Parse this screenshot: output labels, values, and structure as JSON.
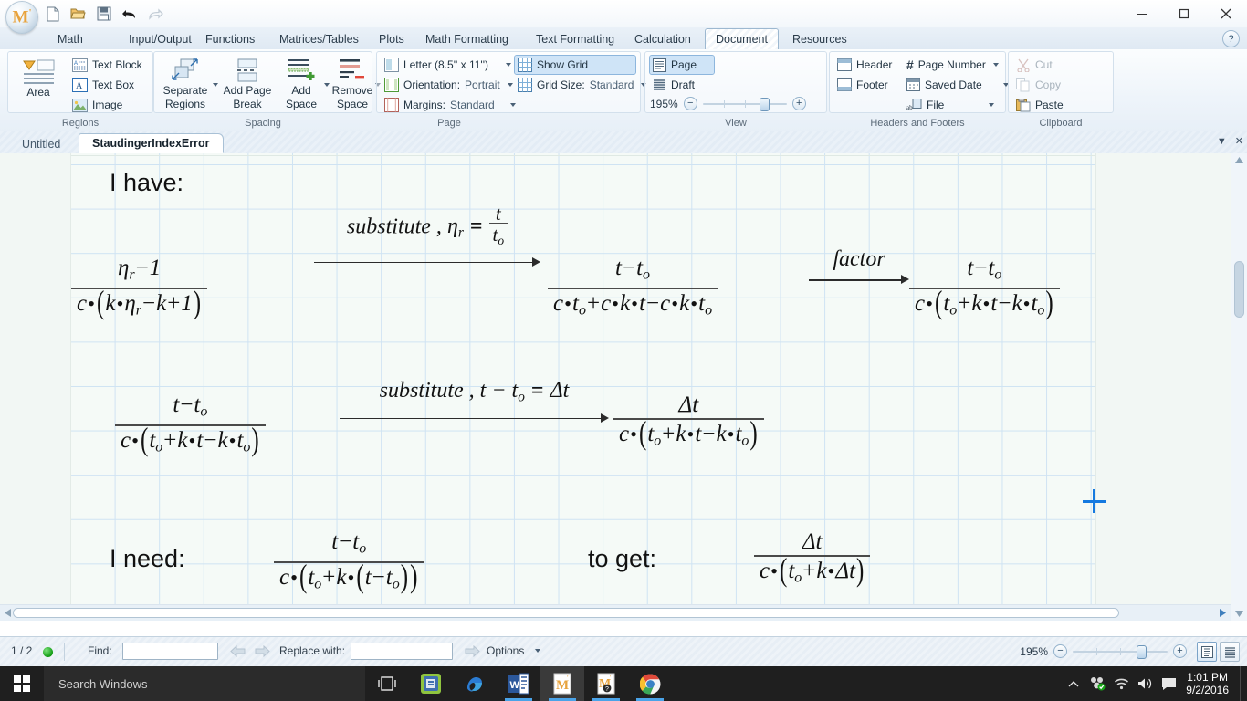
{
  "titlebar": {
    "logo_letter": "M",
    "logo_prime": "'",
    "quick_access": [
      {
        "name": "new-document-icon",
        "label": "New"
      },
      {
        "name": "open-document-icon",
        "label": "Open"
      },
      {
        "name": "save-document-icon",
        "label": "Save"
      },
      {
        "name": "undo-icon",
        "label": "Undo"
      },
      {
        "name": "redo-icon",
        "label": "Redo"
      }
    ],
    "window_controls": [
      {
        "name": "minimize-button",
        "glyph": "–"
      },
      {
        "name": "maximize-button",
        "glyph": "❐"
      },
      {
        "name": "close-button",
        "glyph": "✕"
      }
    ]
  },
  "ribbon": {
    "tabs": [
      {
        "label": "Math",
        "active": false
      },
      {
        "label": "Input/Output",
        "active": false
      },
      {
        "label": "Functions",
        "active": false
      },
      {
        "label": "Matrices/Tables",
        "active": false
      },
      {
        "label": "Plots",
        "active": false
      },
      {
        "label": "Math Formatting",
        "active": false
      },
      {
        "label": "Text Formatting",
        "active": false
      },
      {
        "label": "Calculation",
        "active": false
      },
      {
        "label": "Document",
        "active": true
      },
      {
        "label": "Resources",
        "active": false
      }
    ],
    "help_label": "?",
    "groups": {
      "regions": {
        "title": "Regions",
        "area_label": "Area",
        "items": [
          {
            "label": "Text Block",
            "icon": "text-block-icon"
          },
          {
            "label": "Text Box",
            "icon": "text-box-icon"
          },
          {
            "label": "Image",
            "icon": "image-icon"
          }
        ]
      },
      "spacing": {
        "title": "Spacing",
        "items": [
          {
            "label1": "Separate",
            "label2": "Regions",
            "icon": "separate-regions-icon",
            "has_caret": true
          },
          {
            "label1": "Add Page",
            "label2": "Break",
            "icon": "add-page-break-icon",
            "has_caret": false
          },
          {
            "label1": "Add",
            "label2": "Space",
            "icon": "add-space-icon",
            "has_caret": true
          },
          {
            "label1": "Remove",
            "label2": "Space",
            "icon": "remove-space-icon",
            "has_caret": true
          }
        ]
      },
      "page": {
        "title": "Page",
        "paper_size_label": "Letter (8.5'' x 11'')",
        "orientation_label": "Orientation:",
        "orientation_value": "Portrait",
        "margins_label": "Margins:",
        "margins_value": "Standard",
        "show_grid_label": "Show Grid",
        "show_grid_on": true,
        "grid_size_label": "Grid Size:",
        "grid_size_value": "Standard"
      },
      "view": {
        "title": "View",
        "page_label": "Page",
        "draft_label": "Draft",
        "page_selected": true,
        "zoom_percent": "195%"
      },
      "headers_footers": {
        "title": "Headers and Footers",
        "header_label": "Header",
        "footer_label": "Footer",
        "page_number_label": "Page Number",
        "saved_date_label": "Saved Date",
        "file_label": "File"
      },
      "clipboard": {
        "title": "Clipboard",
        "cut_label": "Cut",
        "copy_label": "Copy",
        "paste_label": "Paste"
      }
    }
  },
  "document_tabs": {
    "tabs": [
      {
        "label": "Untitled",
        "active": false
      },
      {
        "label": "StaudingerIndexError",
        "active": true
      }
    ]
  },
  "worksheet": {
    "label_have": "I have:",
    "label_need": "I need:",
    "label_to_get": "to get:",
    "row1": {
      "expr1": {
        "num": "ηr − 1",
        "den": "c · (k · ηr − k + 1)",
        "num_parts": {
          "eta": "η",
          "sub": "r",
          "rest": "− 1"
        }
      },
      "arrow1_label": "substitute ,",
      "arrow1_eq_lhs": "η",
      "arrow1_eq_lhs_sub": "r",
      "arrow1_eq_op": "=",
      "arrow1_frac_num": "t",
      "arrow1_frac_den": "t",
      "arrow1_frac_den_sub": "o",
      "expr2": {
        "num": "t − t o",
        "den": "c · t o + c · k · t − c · k · t o"
      },
      "arrow2_label": "factor",
      "expr3": {
        "num": "t − t o",
        "den": "c · ( t o + k · t − k · t o )"
      }
    },
    "row2": {
      "expr4": {
        "num": "t − t o",
        "den": "c · ( t o + k · t − k · t o )"
      },
      "arrow3_label": "substitute , t − t",
      "arrow3_sub": "o",
      "arrow3_eq": "=",
      "arrow3_rhs": "Δt",
      "expr5": {
        "num": "Δt",
        "den": "c · ( t o + k · t − k · t o )"
      }
    },
    "row3": {
      "expr6": {
        "num": "t − t o",
        "den": "c · ( t o + k · ( t − t o ) )"
      },
      "expr7": {
        "num": "Δt",
        "den": "c · ( t o + k · Δt )"
      }
    },
    "symbols": {
      "eta": "η",
      "delta": "Δ",
      "minus": "−",
      "plus": "+",
      "dot": "•",
      "equals": "=",
      "lparen": "(",
      "rparen": ")",
      "c": "c",
      "k": "k",
      "t": "t",
      "sub_o": "o",
      "sub_r": "r",
      "one": "1"
    }
  },
  "statusbar": {
    "page_indicator": "1 / 2",
    "find_label": "Find:",
    "find_value": "",
    "replace_label": "Replace with:",
    "replace_value": "",
    "options_label": "Options",
    "zoom_percent": "195%"
  },
  "taskbar": {
    "search_placeholder": "Search Windows",
    "apps": [
      {
        "name": "task-view-icon",
        "label": "Task View"
      },
      {
        "name": "store-icon",
        "label": "Store"
      },
      {
        "name": "edge-icon",
        "label": "Microsoft Edge"
      },
      {
        "name": "word-icon",
        "label": "Word"
      },
      {
        "name": "mathcad-prime-icon",
        "label": "Mathcad Prime",
        "active": true
      },
      {
        "name": "mathcad-help-icon",
        "label": "Mathcad Help"
      },
      {
        "name": "chrome-icon",
        "label": "Google Chrome"
      }
    ],
    "tray": [
      {
        "name": "show-hidden-icons-chevron",
        "label": "Show hidden icons"
      },
      {
        "name": "network-status-icon",
        "label": "Network"
      },
      {
        "name": "wifi-icon",
        "label": "Wi-Fi"
      },
      {
        "name": "volume-icon",
        "label": "Volume"
      },
      {
        "name": "action-center-icon",
        "label": "Action Center"
      }
    ],
    "time": "1:01 PM",
    "date": "9/2/2016"
  },
  "colors": {
    "accent": "#1479e0",
    "ribbon_bg": "#eef4fa",
    "grid_line": "#cfe3f3",
    "page_bg": "#f5faf7",
    "taskbar_bg": "#1f1f1f"
  }
}
